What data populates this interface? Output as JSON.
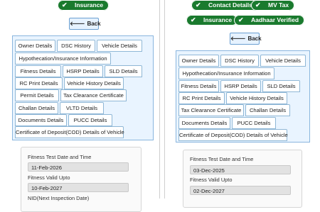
{
  "left": {
    "badges": [
      "Insurance"
    ],
    "back_label": "Back",
    "tabs": [
      "Owner Details",
      "DSC History",
      "Vehicle Details",
      "Hypothecation/Insurance Information",
      "Fitness Details",
      "HSRP Details",
      "SLD Details",
      "RC Print Details",
      "Vehicle History Details",
      "Permit Details",
      "Tax Clearance Certificate",
      "Challan Details",
      "VLTD Details",
      "Documents Details",
      "PUCC Details",
      "Certificate of Deposit(COD) Details of Vehicle"
    ],
    "fields": [
      {
        "label": "Fitness Test Date and Time",
        "value": "11-Feb-2026"
      },
      {
        "label": "Fitness Valid Upto",
        "value": "10-Feb-2027"
      },
      {
        "label": "NID(Next Inspection Date)",
        "value": ""
      }
    ]
  },
  "right": {
    "badges": [
      "Contact Details",
      "MV Tax",
      "Insurance",
      "Aadhaar Verified"
    ],
    "back_label": "Back",
    "tabs": [
      "Owner Details",
      "DSC History",
      "Vehicle Details",
      "Hypothecation/Insurance Information",
      "Fitness Details",
      "HSRP Details",
      "SLD Details",
      "RC Print Details",
      "Vehicle History Details",
      "Tax Clearance Certificate",
      "Challan Details",
      "Documents Details",
      "PUCC Details",
      "Certificate of Deposit(COD) Details of Vehicle"
    ],
    "fields": [
      {
        "label": "Fitness Test Date and Time",
        "value": "03-Dec-2025"
      },
      {
        "label": "Fitness Valid Upto",
        "value": "02-Dec-2027"
      }
    ]
  },
  "icons": {
    "badge_check": "check-icon",
    "back_arrow": "arrow-left-icon"
  },
  "colors": {
    "badge_bg": "#1a7a2e",
    "tab_border": "#8fb7d6",
    "tabs_bg": "#e9f4ff",
    "back_bg": "#e6f2ff"
  }
}
